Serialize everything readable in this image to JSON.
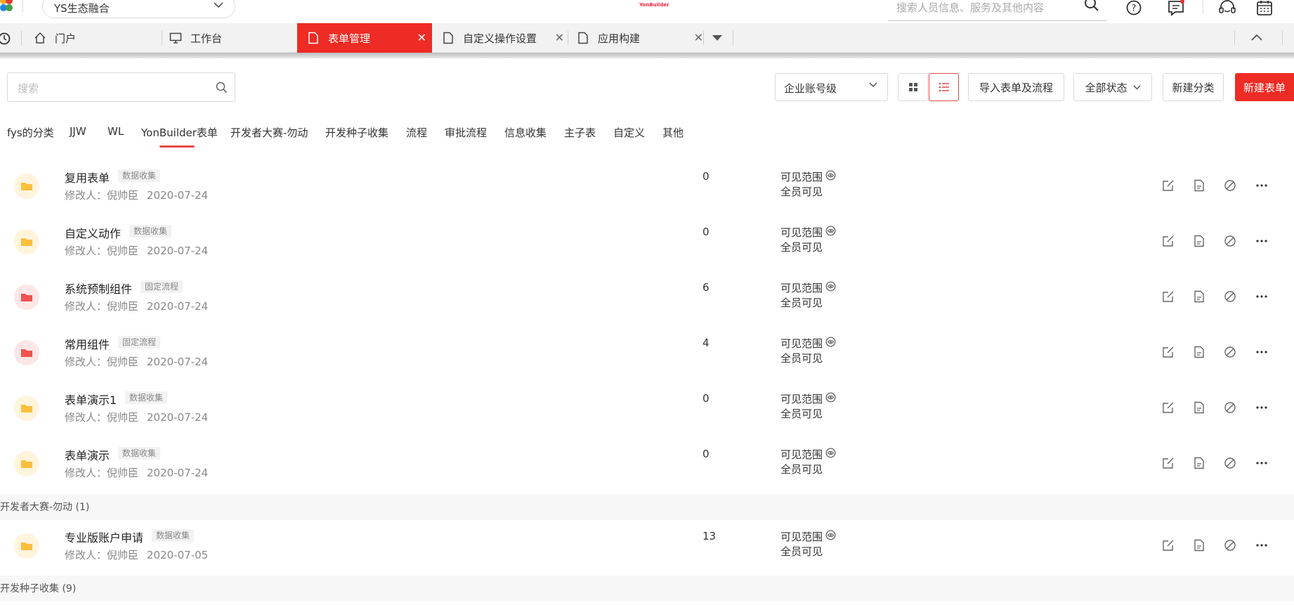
{
  "topbar": {
    "org_name": "YS生态融合",
    "brand_text": "YonBuilder",
    "search_placeholder": "搜索人员信息、服务及其他内容"
  },
  "tabs": [
    {
      "label": "门户",
      "icon": "home-icon"
    },
    {
      "label": "工作台",
      "icon": "monitor-icon"
    },
    {
      "label": "表单管理",
      "icon": "document-icon",
      "active": true
    },
    {
      "label": "自定义操作设置",
      "icon": "document-icon"
    },
    {
      "label": "应用构建",
      "icon": "document-icon"
    }
  ],
  "toolbar": {
    "search_placeholder": "搜索",
    "account_level": "企业账号级",
    "import_label": "导入表单及流程",
    "status_filter": "全部状态",
    "new_category_label": "新建分类",
    "new_form_label": "新建表单"
  },
  "categories": [
    "fys的分类",
    "JJW",
    "WL",
    "YonBuilder表单",
    "开发者大赛-勿动",
    "开发种子收集",
    "流程",
    "审批流程",
    "信息收集",
    "主子表",
    "自定义",
    "其他"
  ],
  "active_category": "YonBuilder表单",
  "labels": {
    "modifier_prefix": "修改人：",
    "visibility_title": "可见范围",
    "visibility_value": "全员可见"
  },
  "rows": [
    {
      "name": "复用表单",
      "tag": "数据收集",
      "modifier": "倪帅臣",
      "date": "2020-07-24",
      "count": "0",
      "color": "yellow"
    },
    {
      "name": "自定义动作",
      "tag": "数据收集",
      "modifier": "倪帅臣",
      "date": "2020-07-24",
      "count": "0",
      "color": "yellow"
    },
    {
      "name": "系统预制组件",
      "tag": "固定流程",
      "modifier": "倪帅臣",
      "date": "2020-07-24",
      "count": "6",
      "color": "red"
    },
    {
      "name": "常用组件",
      "tag": "固定流程",
      "modifier": "倪帅臣",
      "date": "2020-07-24",
      "count": "4",
      "color": "red"
    },
    {
      "name": "表单演示1",
      "tag": "数据收集",
      "modifier": "倪帅臣",
      "date": "2020-07-24",
      "count": "0",
      "color": "yellow"
    },
    {
      "name": "表单演示",
      "tag": "数据收集",
      "modifier": "倪帅臣",
      "date": "2020-07-24",
      "count": "0",
      "color": "yellow"
    }
  ],
  "groups": [
    {
      "title": "开发者大赛-勿动",
      "count": "(1)"
    },
    {
      "title": "开发种子收集",
      "count": "(9)"
    }
  ],
  "group_rows": [
    {
      "name": "专业版账户申请",
      "tag": "数据收集",
      "modifier": "倪帅臣",
      "date": "2020-07-05",
      "count": "13",
      "color": "yellow"
    }
  ],
  "colors": {
    "accent": "#ee2b24",
    "folder_yellow": "#fbbf3c",
    "folder_yellow_bg": "#fff4dc",
    "folder_red": "#ee5350",
    "folder_red_bg": "#fde6e6"
  }
}
